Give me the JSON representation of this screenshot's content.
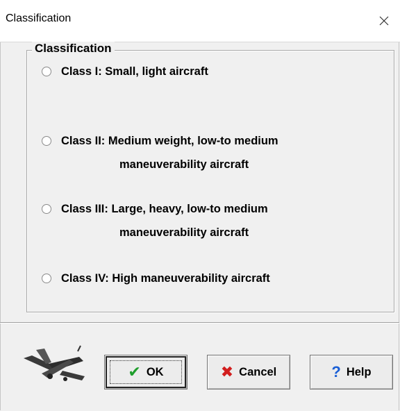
{
  "window": {
    "title": "Classification"
  },
  "group": {
    "title": "Classification",
    "options": [
      {
        "line1": "Class I: Small, light aircraft",
        "line2": ""
      },
      {
        "line1": "Class II: Medium weight, low-to medium",
        "line2": "maneuverability aircraft"
      },
      {
        "line1": "Class III: Large, heavy, low-to medium",
        "line2": "maneuverability aircraft"
      },
      {
        "line1": "Class IV: High maneuverability aircraft",
        "line2": ""
      }
    ]
  },
  "buttons": {
    "ok": "OK",
    "cancel": "Cancel",
    "help": "Help"
  },
  "icons": {
    "close": "close-icon",
    "check": "check-icon",
    "cancel": "x-icon",
    "help": "question-icon",
    "plane": "airplane-icon"
  },
  "colors": {
    "check": "#1f9e2c",
    "cancel": "#d21e1e",
    "help": "#1a5fd6"
  }
}
